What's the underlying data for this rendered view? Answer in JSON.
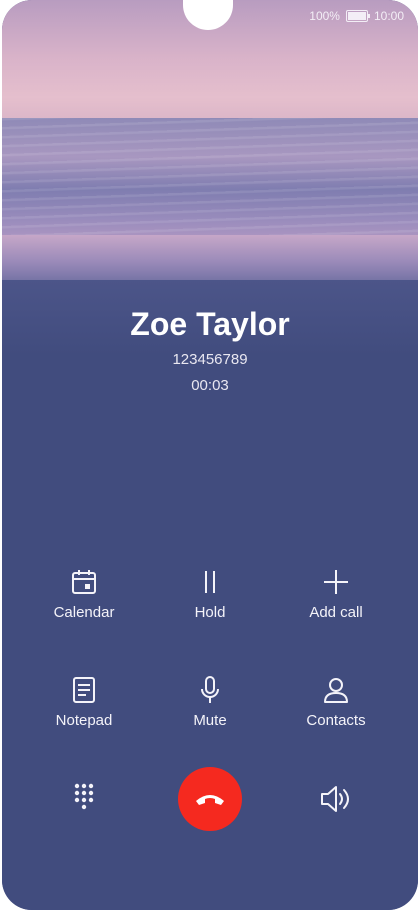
{
  "status_bar": {
    "battery_percent": "100%",
    "time": "10:00"
  },
  "caller": {
    "name": "Zoe Taylor",
    "number": "123456789",
    "duration": "00:03"
  },
  "actions": [
    {
      "label": "Calendar",
      "icon": "calendar-icon"
    },
    {
      "label": "Hold",
      "icon": "pause-icon"
    },
    {
      "label": "Add call",
      "icon": "plus-icon"
    },
    {
      "label": "Notepad",
      "icon": "notepad-icon"
    },
    {
      "label": "Mute",
      "icon": "microphone-icon"
    },
    {
      "label": "Contacts",
      "icon": "person-icon"
    }
  ],
  "bottom_bar": {
    "dialpad_icon": "dialpad-icon",
    "end_call_icon": "hang-up-icon",
    "speaker_icon": "speaker-icon",
    "end_call_color": "#f5291f"
  },
  "colors": {
    "background": "#414c7e",
    "text": "#ffffff"
  }
}
